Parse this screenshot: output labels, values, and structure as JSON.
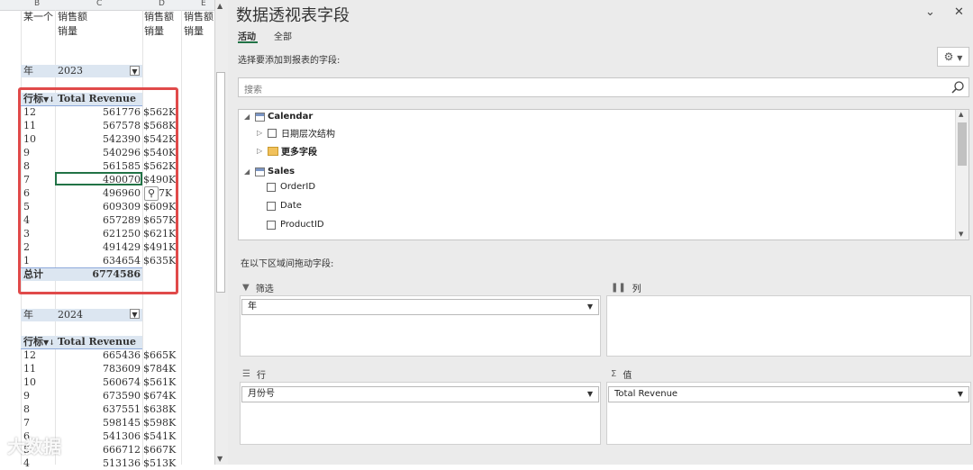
{
  "sheet": {
    "columns": [
      "B",
      "C",
      "D",
      "E"
    ],
    "row1": {
      "b": "某一个",
      "c": "销售额",
      "d": "销售额",
      "e": "销售额"
    },
    "row2": {
      "c": "销量",
      "d": "销量",
      "e": "销量"
    },
    "pivot2023": {
      "filter_label": "年",
      "filter_value": "2023",
      "hdr_row": "行标",
      "hdr_value": "Total Revenue",
      "rows": [
        {
          "m": "12",
          "v": "561776",
          "k": "$562K"
        },
        {
          "m": "11",
          "v": "567578",
          "k": "$568K"
        },
        {
          "m": "10",
          "v": "542390",
          "k": "$542K"
        },
        {
          "m": "9",
          "v": "540296",
          "k": "$540K"
        },
        {
          "m": "8",
          "v": "561585",
          "k": "$562K"
        },
        {
          "m": "7",
          "v": "490070",
          "k": "$490K"
        },
        {
          "m": "6",
          "v": "496960",
          "k": "7K"
        },
        {
          "m": "5",
          "v": "609309",
          "k": "$609K"
        },
        {
          "m": "4",
          "v": "657289",
          "k": "$657K"
        },
        {
          "m": "3",
          "v": "621250",
          "k": "$621K"
        },
        {
          "m": "2",
          "v": "491429",
          "k": "$491K"
        },
        {
          "m": "1",
          "v": "634654",
          "k": "$635K"
        }
      ],
      "total_label": "总计",
      "total_value": "6774586"
    },
    "pivot2024": {
      "filter_label": "年",
      "filter_value": "2024",
      "hdr_row": "行标",
      "hdr_value": "Total Revenue",
      "rows": [
        {
          "m": "12",
          "v": "665436",
          "k": "$665K"
        },
        {
          "m": "11",
          "v": "783609",
          "k": "$784K"
        },
        {
          "m": "10",
          "v": "560674",
          "k": "$561K"
        },
        {
          "m": "9",
          "v": "673590",
          "k": "$674K"
        },
        {
          "m": "8",
          "v": "637551",
          "k": "$638K"
        },
        {
          "m": "7",
          "v": "598145",
          "k": "$598K"
        },
        {
          "m": "6",
          "v": "541306",
          "k": "$541K"
        },
        {
          "m": "5",
          "v": "666712",
          "k": "$667K"
        },
        {
          "m": "4",
          "v": "513136",
          "k": "$513K"
        }
      ]
    },
    "watermark": "大数据",
    "accent_red": "#e04a4a",
    "selection_green": "#217346"
  },
  "pane": {
    "title": "数据透视表字段",
    "tabs": [
      "活动",
      "全部"
    ],
    "choose_label": "选择要添加到报表的字段:",
    "search_placeholder": "搜索",
    "field_list": {
      "calendar": "Calendar",
      "date_hierarchy": "日期层次结构",
      "more_fields": "更多字段",
      "sales": "Sales",
      "order_id": "OrderID",
      "date": "Date",
      "product_id": "ProductID"
    },
    "drag_label": "在以下区域间拖动字段:",
    "zones": {
      "filters": {
        "title": "筛选",
        "value": "年"
      },
      "columns": {
        "title": "列"
      },
      "rows": {
        "title": "行",
        "value": "月份号"
      },
      "values": {
        "title": "值",
        "value": "Total Revenue"
      }
    }
  }
}
